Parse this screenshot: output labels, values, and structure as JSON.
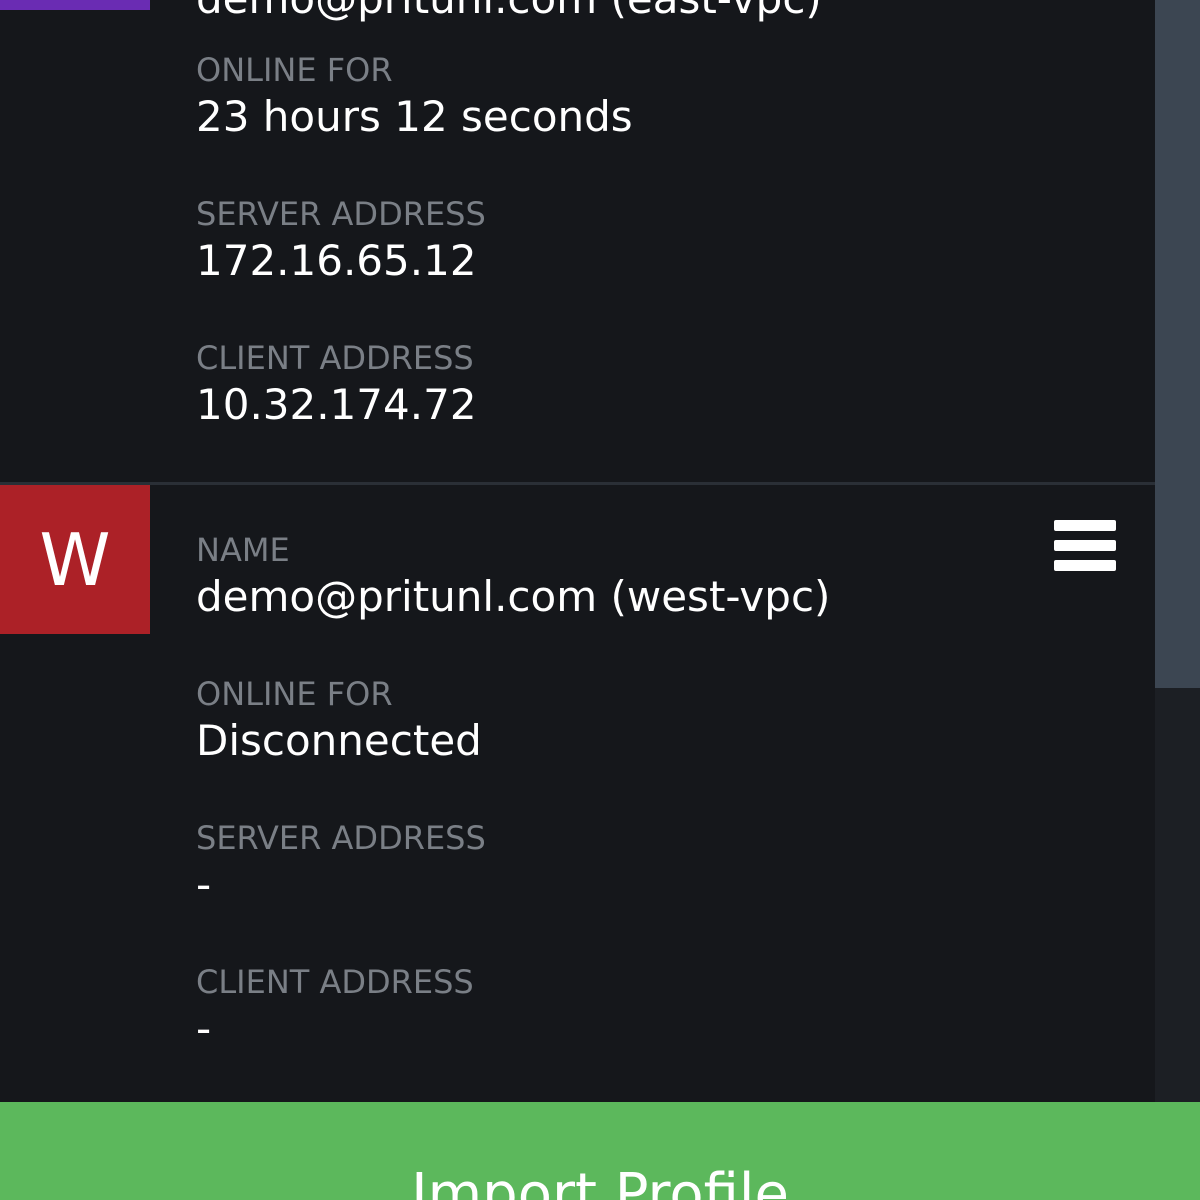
{
  "colors": {
    "background": "#15171b",
    "label": "#7a7f86",
    "value": "#ffffff",
    "badge_top": "#6a2cb3",
    "badge_w": "#ac2127",
    "import_button": "#5cb85c",
    "scroll_thumb": "#3c4652"
  },
  "profiles": [
    {
      "badge_letter": "",
      "name_value_partial": "demo@pritunl.com (east-vpc)",
      "online_for_label": "ONLINE FOR",
      "online_for_value": "23 hours 12 seconds",
      "server_address_label": "SERVER ADDRESS",
      "server_address_value": "172.16.65.12",
      "client_address_label": "CLIENT ADDRESS",
      "client_address_value": "10.32.174.72"
    },
    {
      "badge_letter": "W",
      "name_label": "NAME",
      "name_value": "demo@pritunl.com (west-vpc)",
      "menu_icon": "hamburger-menu-icon",
      "online_for_label": "ONLINE FOR",
      "online_for_value": "Disconnected",
      "server_address_label": "SERVER ADDRESS",
      "server_address_value": "-",
      "client_address_label": "CLIENT ADDRESS",
      "client_address_value": "-"
    }
  ],
  "import_button": {
    "label": "Import Profile"
  }
}
